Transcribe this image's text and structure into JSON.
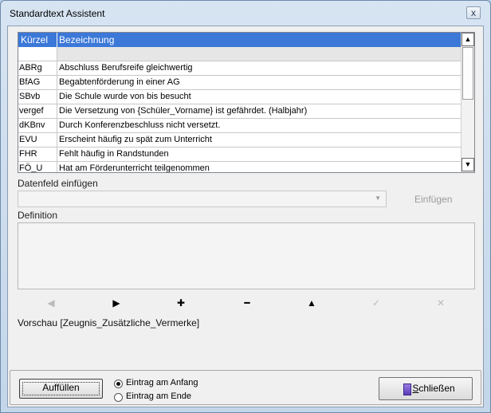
{
  "window": {
    "title": "Standardtext Assistent",
    "close_glyph": "x"
  },
  "grid": {
    "headers": {
      "kuerzel": "Kürzel",
      "bezeichnung": "Bezeichnung"
    },
    "rows": [
      {
        "kuerzel": "",
        "bezeichnung": ""
      },
      {
        "kuerzel": "ABRg",
        "bezeichnung": "Abschluss Berufsreife gleichwertig"
      },
      {
        "kuerzel": "BfAG",
        "bezeichnung": "Begabtenförderung in einer AG"
      },
      {
        "kuerzel": "SBvb",
        "bezeichnung": "Die Schule wurde von bis besucht"
      },
      {
        "kuerzel": "vergef",
        "bezeichnung": "Die Versetzung von {Schüler_Vorname} ist gefährdet. (Halbjahr)"
      },
      {
        "kuerzel": "dKBnv",
        "bezeichnung": "Durch Konferenzbeschluss nicht versetzt."
      },
      {
        "kuerzel": "EVU",
        "bezeichnung": "Erscheint häufig zu spät zum Unterricht"
      },
      {
        "kuerzel": "FHR",
        "bezeichnung": "Fehlt häufig in Randstunden"
      },
      {
        "kuerzel": "FÖ_U",
        "bezeichnung": "Hat am Förderunterricht teilgenommen"
      }
    ],
    "scroll_up_glyph": "▲",
    "scroll_down_glyph": "▼"
  },
  "datenfeld": {
    "label": "Datenfeld einfügen",
    "select_value": "",
    "insert_button": "Einfügen"
  },
  "definition": {
    "label": "Definition",
    "value": ""
  },
  "toolbar": {
    "icons": [
      {
        "name": "arrow-left-icon",
        "glyph": "◀",
        "enabled": false
      },
      {
        "name": "arrow-right-icon",
        "glyph": "▶",
        "enabled": true
      },
      {
        "name": "plus-icon",
        "glyph": "✚",
        "enabled": true
      },
      {
        "name": "minus-icon",
        "glyph": "━",
        "enabled": true
      },
      {
        "name": "arrow-up-icon",
        "glyph": "▲",
        "enabled": true
      },
      {
        "name": "check-icon",
        "glyph": "✓",
        "enabled": false
      },
      {
        "name": "cancel-icon",
        "glyph": "✕",
        "enabled": false
      }
    ]
  },
  "preview": {
    "label": "Vorschau [Zeugnis_Zusätzliche_Vermerke]"
  },
  "footer": {
    "fill_button": "Auffüllen",
    "radio_start": "Eintrag am Anfang",
    "radio_end": "Eintrag am Ende",
    "selected_radio": "start",
    "close_button_first": "S",
    "close_button_rest": "chließen"
  }
}
